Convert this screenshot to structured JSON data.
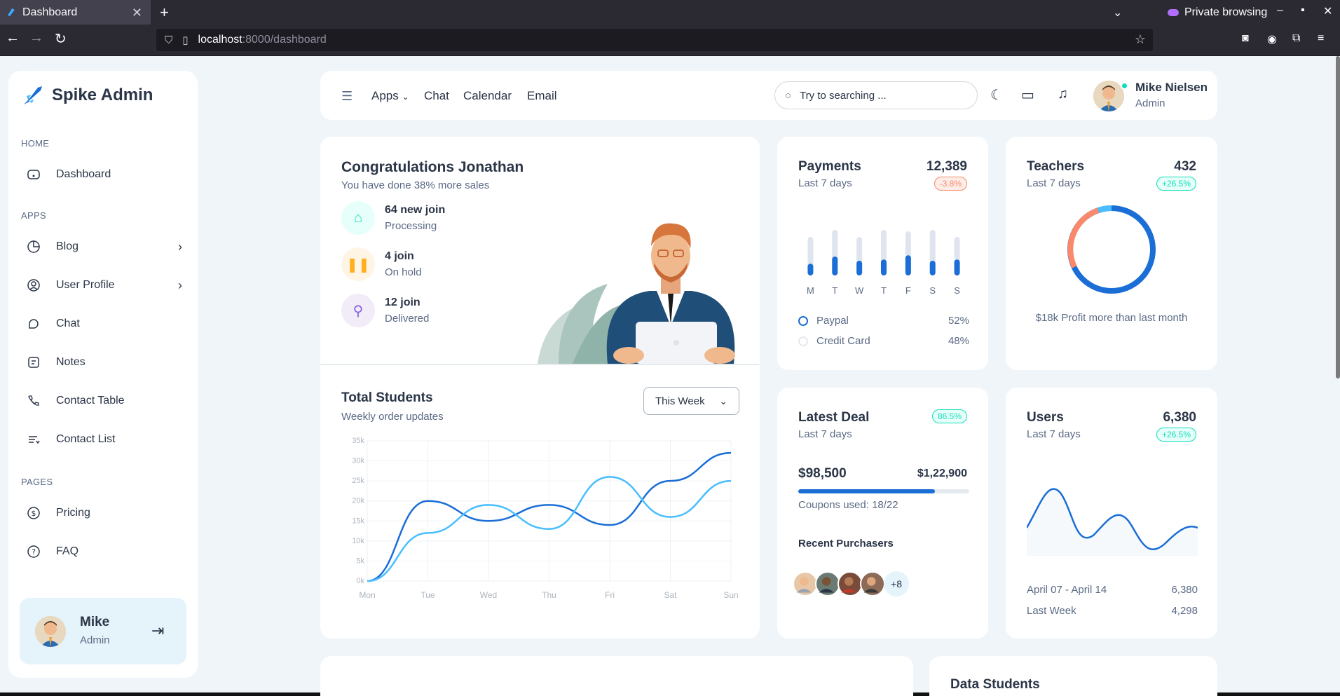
{
  "browser": {
    "tab_title": "Dashboard",
    "url_host": "localhost",
    "url_path": ":8000/dashboard",
    "private_label": "Private browsing"
  },
  "sidebar": {
    "brand": "Spike Admin",
    "sections": {
      "home": "HOME",
      "apps": "APPS",
      "pages": "PAGES"
    },
    "items": [
      {
        "label": "Dashboard",
        "icon": "dashboard-icon"
      },
      {
        "label": "Blog",
        "icon": "blog-icon"
      },
      {
        "label": "User Profile",
        "icon": "user-profile-icon"
      },
      {
        "label": "Chat",
        "icon": "chat-icon"
      },
      {
        "label": "Notes",
        "icon": "notes-icon"
      },
      {
        "label": "Contact Table",
        "icon": "phone-icon"
      },
      {
        "label": "Contact List",
        "icon": "list-icon"
      },
      {
        "label": "Pricing",
        "icon": "dollar-icon"
      },
      {
        "label": "FAQ",
        "icon": "question-icon"
      }
    ],
    "profile": {
      "name": "Mike",
      "role": "Admin"
    }
  },
  "header": {
    "links": [
      "Apps",
      "Chat",
      "Calendar",
      "Email"
    ],
    "search_placeholder": "Try to searching ...",
    "user_name": "Mike Nielsen",
    "user_role": "Admin"
  },
  "congrats": {
    "title": "Congratulations Jonathan",
    "subtitle": "You have done 38% more sales",
    "rows": [
      {
        "title": "64 new join",
        "status": "Processing",
        "color": "#13deb9"
      },
      {
        "title": "4 join",
        "status": "On hold",
        "color": "#ffae1f"
      },
      {
        "title": "12 join",
        "status": "Delivered",
        "color": "#8763da"
      }
    ]
  },
  "students": {
    "title": "Total Students",
    "subtitle": "Weekly order updates",
    "filter": "This Week"
  },
  "chart_data": {
    "type": "line",
    "title": "Total Students",
    "categories": [
      "Mon",
      "Tue",
      "Wed",
      "Thu",
      "Fri",
      "Sat",
      "Sun"
    ],
    "y_ticks": [
      "35k",
      "30k",
      "25k",
      "20k",
      "15k",
      "10k",
      "5k",
      "0k"
    ],
    "ylim": [
      0,
      35000
    ],
    "series": [
      {
        "color": "#1a6ed6",
        "values": [
          0,
          20000,
          15000,
          19000,
          14000,
          25000,
          32000
        ]
      },
      {
        "color": "#49beff",
        "values": [
          0,
          12000,
          19000,
          13000,
          26000,
          16000,
          25000
        ]
      }
    ]
  },
  "payments": {
    "title": "Payments",
    "value": "12,389",
    "subtitle": "Last 7 days",
    "badge": "-3.8%",
    "days": [
      "M",
      "T",
      "W",
      "T",
      "F",
      "S",
      "S"
    ],
    "bar_levels": [
      0.28,
      0.45,
      0.35,
      0.38,
      0.48,
      0.35,
      0.38
    ],
    "legend": [
      {
        "label": "Paypal",
        "pct": "52%"
      },
      {
        "label": "Credit Card",
        "pct": "48%"
      }
    ]
  },
  "teachers": {
    "title": "Teachers",
    "value": "432",
    "subtitle": "Last 7 days",
    "badge": "+26.5%",
    "note": "$18k Profit more than last month"
  },
  "deal": {
    "title": "Latest Deal",
    "badge": "86.5%",
    "subtitle": "Last 7 days",
    "amount": "$98,500",
    "target": "$1,22,900",
    "progress": 0.8,
    "coupons": "Coupons used: 18/22",
    "purchasers_label": "Recent Purchasers",
    "more": "+8"
  },
  "users": {
    "title": "Users",
    "value": "6,380",
    "subtitle": "Last 7 days",
    "badge": "+26.5%",
    "rows": [
      {
        "label": "April 07 - April 14",
        "value": "6,380"
      },
      {
        "label": "Last Week",
        "value": "4,298"
      }
    ]
  },
  "bottom": {
    "data_students_title": "Data Students"
  }
}
